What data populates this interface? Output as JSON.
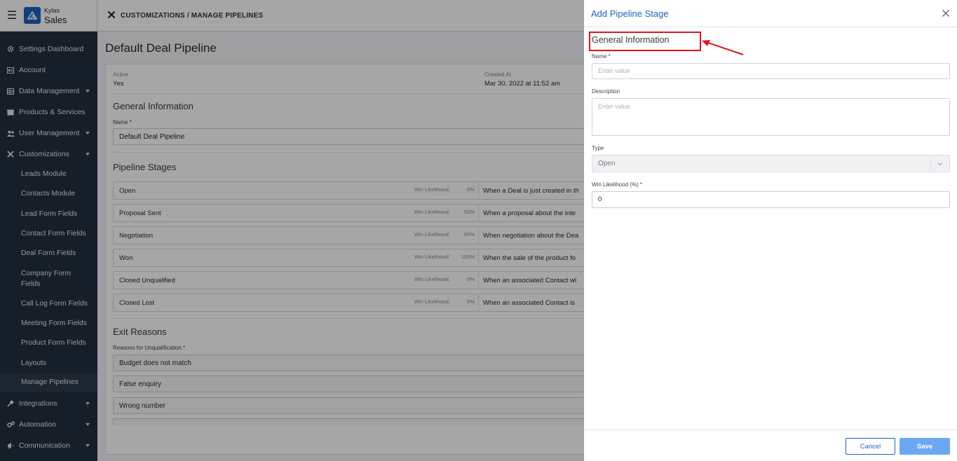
{
  "brand": {
    "line1": "Kylas",
    "line2": "Sales"
  },
  "breadcrumb": "CUSTOMIZATIONS / MANAGE PIPELINES",
  "sidebar": {
    "items": [
      {
        "label": "Settings Dashboard",
        "icon": "gear-icon"
      },
      {
        "label": "Account",
        "icon": "id-card-icon"
      },
      {
        "label": "Data Management",
        "icon": "table-icon"
      },
      {
        "label": "Products & Services",
        "icon": "box-icon"
      },
      {
        "label": "User Management",
        "icon": "users-icon"
      },
      {
        "label": "Customizations",
        "icon": "tools-icon"
      },
      {
        "label": "Integrations",
        "icon": "plug-icon"
      },
      {
        "label": "Automation",
        "icon": "cogs-icon"
      },
      {
        "label": "Communication",
        "icon": "megaphone-icon"
      }
    ],
    "subitems": [
      "Leads Module",
      "Contacts Module",
      "Lead Form Fields",
      "Contact Form Fields",
      "Deal Form Fields",
      "Company Form Fields",
      "Call Log Form Fields",
      "Meeting Form Fields",
      "Product Form Fields",
      "Layouts",
      "Manage Pipelines"
    ]
  },
  "main": {
    "title": "Default Deal Pipeline",
    "active_label": "Active",
    "active_value": "Yes",
    "created_label": "Created At",
    "created_value": "Mar 30, 2022 at 11:52 am",
    "general_heading": "General Information",
    "name_label": "Name *",
    "name_value": "Default Deal Pipeline",
    "stages_heading": "Pipeline Stages",
    "win_label": "Win Likelihood:",
    "stages": [
      {
        "name": "Open",
        "pct": "0%",
        "desc": "When a Deal is just created in th"
      },
      {
        "name": "Proposal Sent",
        "pct": "50%",
        "desc": "When a proposal about the inte"
      },
      {
        "name": "Negotiation",
        "pct": "80%",
        "desc": "When negotiation about the Dea"
      },
      {
        "name": "Won",
        "pct": "100%",
        "desc": "When the sale of the product fo"
      },
      {
        "name": "Closed Unqualified",
        "pct": "0%",
        "desc": "When an associated Contact wi"
      },
      {
        "name": "Closed Lost",
        "pct": "0%",
        "desc": "When an associated Contact is"
      }
    ],
    "exit_heading": "Exit Reasons",
    "reasons_label": "Reasons for Unqualification *",
    "reasons": [
      "Budget does not match",
      "False enquiry",
      "Wrong number"
    ]
  },
  "panel": {
    "title": "Add Pipeline Stage",
    "section": "General Information",
    "name_label": "Name *",
    "name_placeholder": "Enter value",
    "desc_label": "Description",
    "desc_placeholder": "Enter value",
    "type_label": "Type",
    "type_value": "Open",
    "win_label": "Win Likelihood (%) *",
    "win_value": "0",
    "cancel_label": "Cancel",
    "save_label": "Save"
  },
  "colors": {
    "accent": "#1f62c2",
    "save": "#6ca8f2",
    "highlight": "#e0141a",
    "sidebar": "#22303f"
  }
}
